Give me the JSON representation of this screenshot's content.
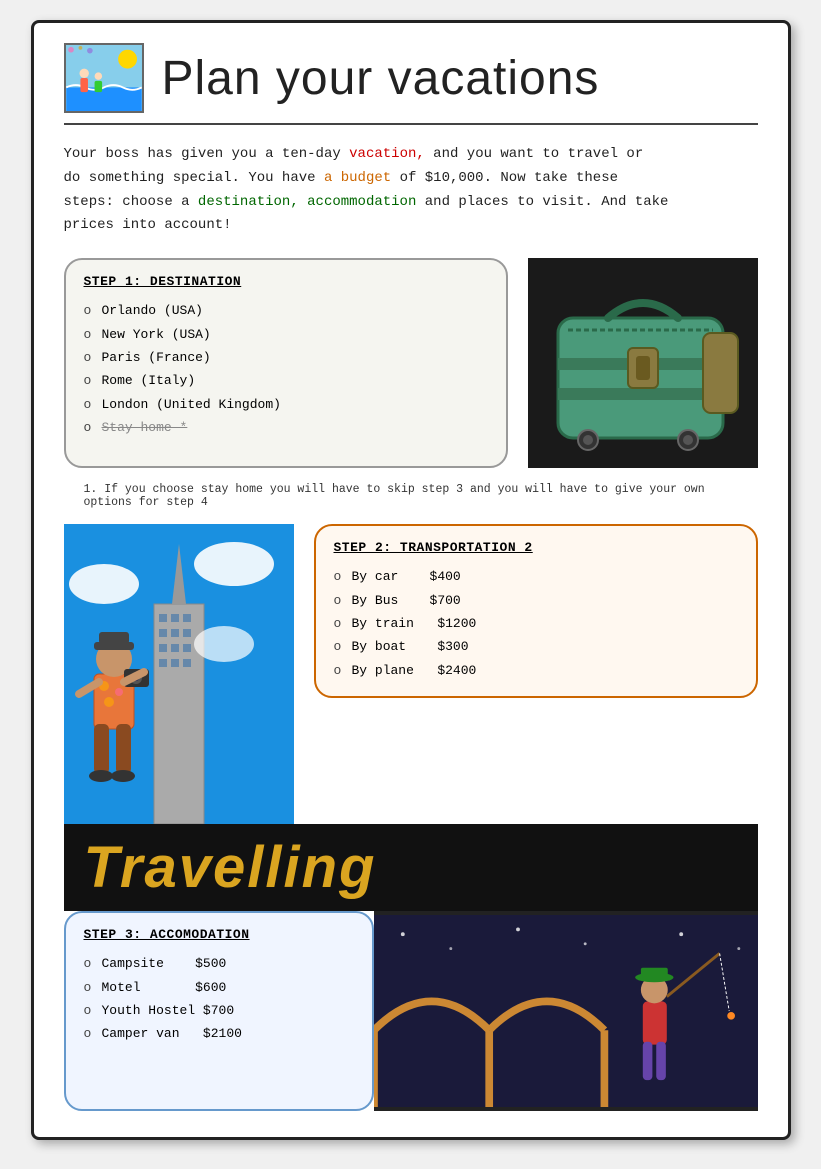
{
  "header": {
    "title": "Plan your vacations"
  },
  "intro": {
    "text_parts": [
      {
        "text": "Your boss has given you a ten-day ",
        "style": "normal"
      },
      {
        "text": "vacation,",
        "style": "red"
      },
      {
        "text": " and you want to travel or do something special. You have ",
        "style": "normal"
      },
      {
        "text": "a budget",
        "style": "orange"
      },
      {
        "text": " of $10,000. ",
        "style": "normal"
      },
      {
        "text": "Now take these",
        "style": "normal"
      },
      {
        "text": " steps: choose a ",
        "style": "normal"
      },
      {
        "text": "destination, accommodation",
        "style": "green"
      },
      {
        "text": " and places to visit. And take prices into account!",
        "style": "normal"
      }
    ]
  },
  "step1": {
    "title": "STEP 1: DESTINATION",
    "items": [
      {
        "text": "Orlando (USA)",
        "strikethrough": false
      },
      {
        "text": "New York (USA)",
        "strikethrough": false
      },
      {
        "text": "Paris (France)",
        "strikethrough": false
      },
      {
        "text": "Rome (Italy)",
        "strikethrough": false
      },
      {
        "text": "London (United Kingdom)",
        "strikethrough": false
      },
      {
        "text": "Stay home *",
        "strikethrough": true
      }
    ]
  },
  "footnote": {
    "text": "1.   If you choose stay home you will have to skip step 3 and you will have to give your own options for step 4"
  },
  "step2": {
    "title": "STEP 2: TRANSPORTATION 2",
    "items": [
      {
        "label": "By car",
        "price": "$400"
      },
      {
        "label": "By Bus",
        "price": "$700"
      },
      {
        "label": "By train",
        "price": "$1200"
      },
      {
        "label": "By boat",
        "price": "$300"
      },
      {
        "label": "By plane",
        "price": "$2400"
      }
    ]
  },
  "travelling": {
    "text": "Travelling"
  },
  "step3": {
    "title": "STEP 3: ACCOMODATION",
    "items": [
      {
        "label": "Campsite",
        "price": "$500"
      },
      {
        "label": "Motel",
        "price": "$600"
      },
      {
        "label": "Youth Hostel",
        "price": "$700"
      },
      {
        "label": "Camper van",
        "price": "$2100"
      }
    ]
  }
}
